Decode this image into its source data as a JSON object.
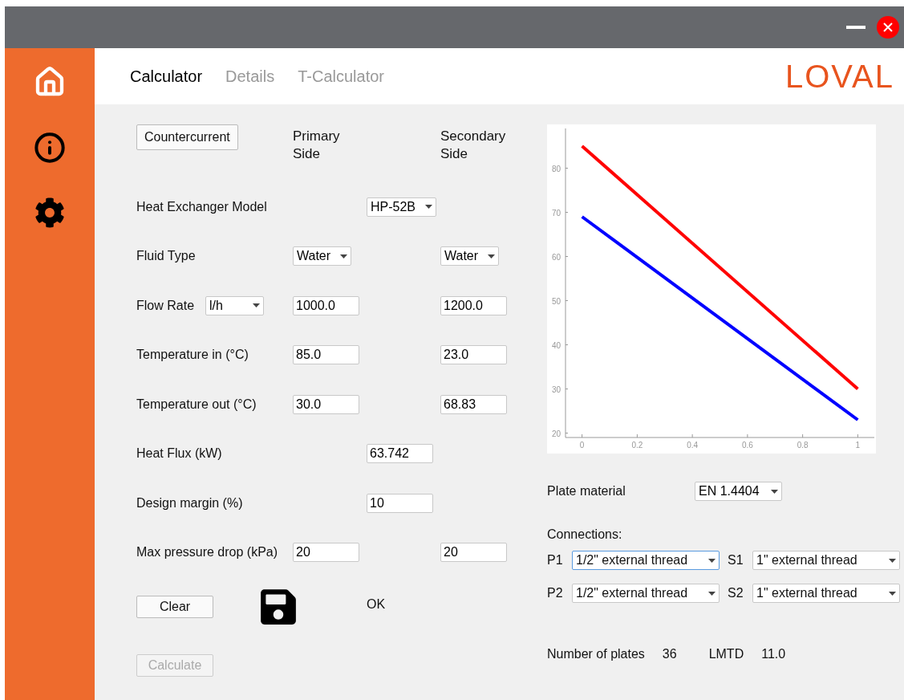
{
  "tabs": [
    {
      "label": "Calculator",
      "selected": true
    },
    {
      "label": "Details",
      "selected": false
    },
    {
      "label": "T-Calculator",
      "selected": false
    }
  ],
  "logo": "LOVAL",
  "form": {
    "mode_button": "Countercurrent",
    "primary_heading": "Primary Side",
    "secondary_heading": "Secondary Side",
    "rows": [
      {
        "label": "Heat Exchanger Model",
        "middle": {
          "kind": "select",
          "value": "HP-52B"
        }
      },
      {
        "label": "Fluid Type",
        "primary": {
          "kind": "select",
          "value": "Water"
        },
        "secondary": {
          "kind": "select",
          "value": "Water"
        }
      },
      {
        "label": "Flow Rate",
        "unit": {
          "kind": "select",
          "value": "l/h"
        },
        "primary": {
          "kind": "input",
          "value": "1000.0"
        },
        "secondary": {
          "kind": "input",
          "value": "1200.0"
        }
      },
      {
        "label": "Temperature in (°C)",
        "primary": {
          "kind": "input",
          "value": "85.0"
        },
        "secondary": {
          "kind": "input",
          "value": "23.0"
        }
      },
      {
        "label": "Temperature out (°C)",
        "primary": {
          "kind": "input",
          "value": "30.0"
        },
        "secondary": {
          "kind": "input",
          "value": "68.83"
        }
      },
      {
        "label": "Heat Flux (kW)",
        "middle": {
          "kind": "input",
          "value": "63.742"
        }
      },
      {
        "label": "Design margin (%)",
        "middle": {
          "kind": "input",
          "value": "10"
        }
      },
      {
        "label": "Max pressure drop (kPa)",
        "primary": {
          "kind": "input",
          "value": "20"
        },
        "secondary": {
          "kind": "input",
          "value": "20"
        }
      }
    ],
    "clear_button": "Clear",
    "status": "OK",
    "calculate_button": {
      "label": "Calculate",
      "disabled": true
    }
  },
  "chart_data": {
    "type": "line",
    "x": [
      0,
      1
    ],
    "series": [
      {
        "color": "#ff0000",
        "values": [
          85,
          30
        ]
      },
      {
        "color": "#0000ff",
        "values": [
          69,
          23
        ]
      }
    ],
    "ylim": [
      19,
      89
    ],
    "xlim": [
      -0.06,
      1.06
    ],
    "xticks": [
      0,
      0.2,
      0.4,
      0.6,
      0.8,
      1
    ],
    "yticks": [
      20,
      30,
      40,
      50,
      60,
      70,
      80
    ]
  },
  "plate_material": {
    "label": "Plate material",
    "value": "EN 1.4404"
  },
  "connections": {
    "label": "Connections:",
    "items": [
      {
        "port": "P1",
        "value": "1/2\" external thread",
        "focused": true
      },
      {
        "port": "S1",
        "value": "1\" external thread",
        "focused": false
      },
      {
        "port": "P2",
        "value": "1/2\" external thread",
        "focused": false
      },
      {
        "port": "S2",
        "value": "1\" external thread",
        "focused": false
      }
    ]
  },
  "results": [
    {
      "label": "Number of plates",
      "value": "36"
    },
    {
      "label": "LMTD",
      "value": "11.0"
    }
  ]
}
